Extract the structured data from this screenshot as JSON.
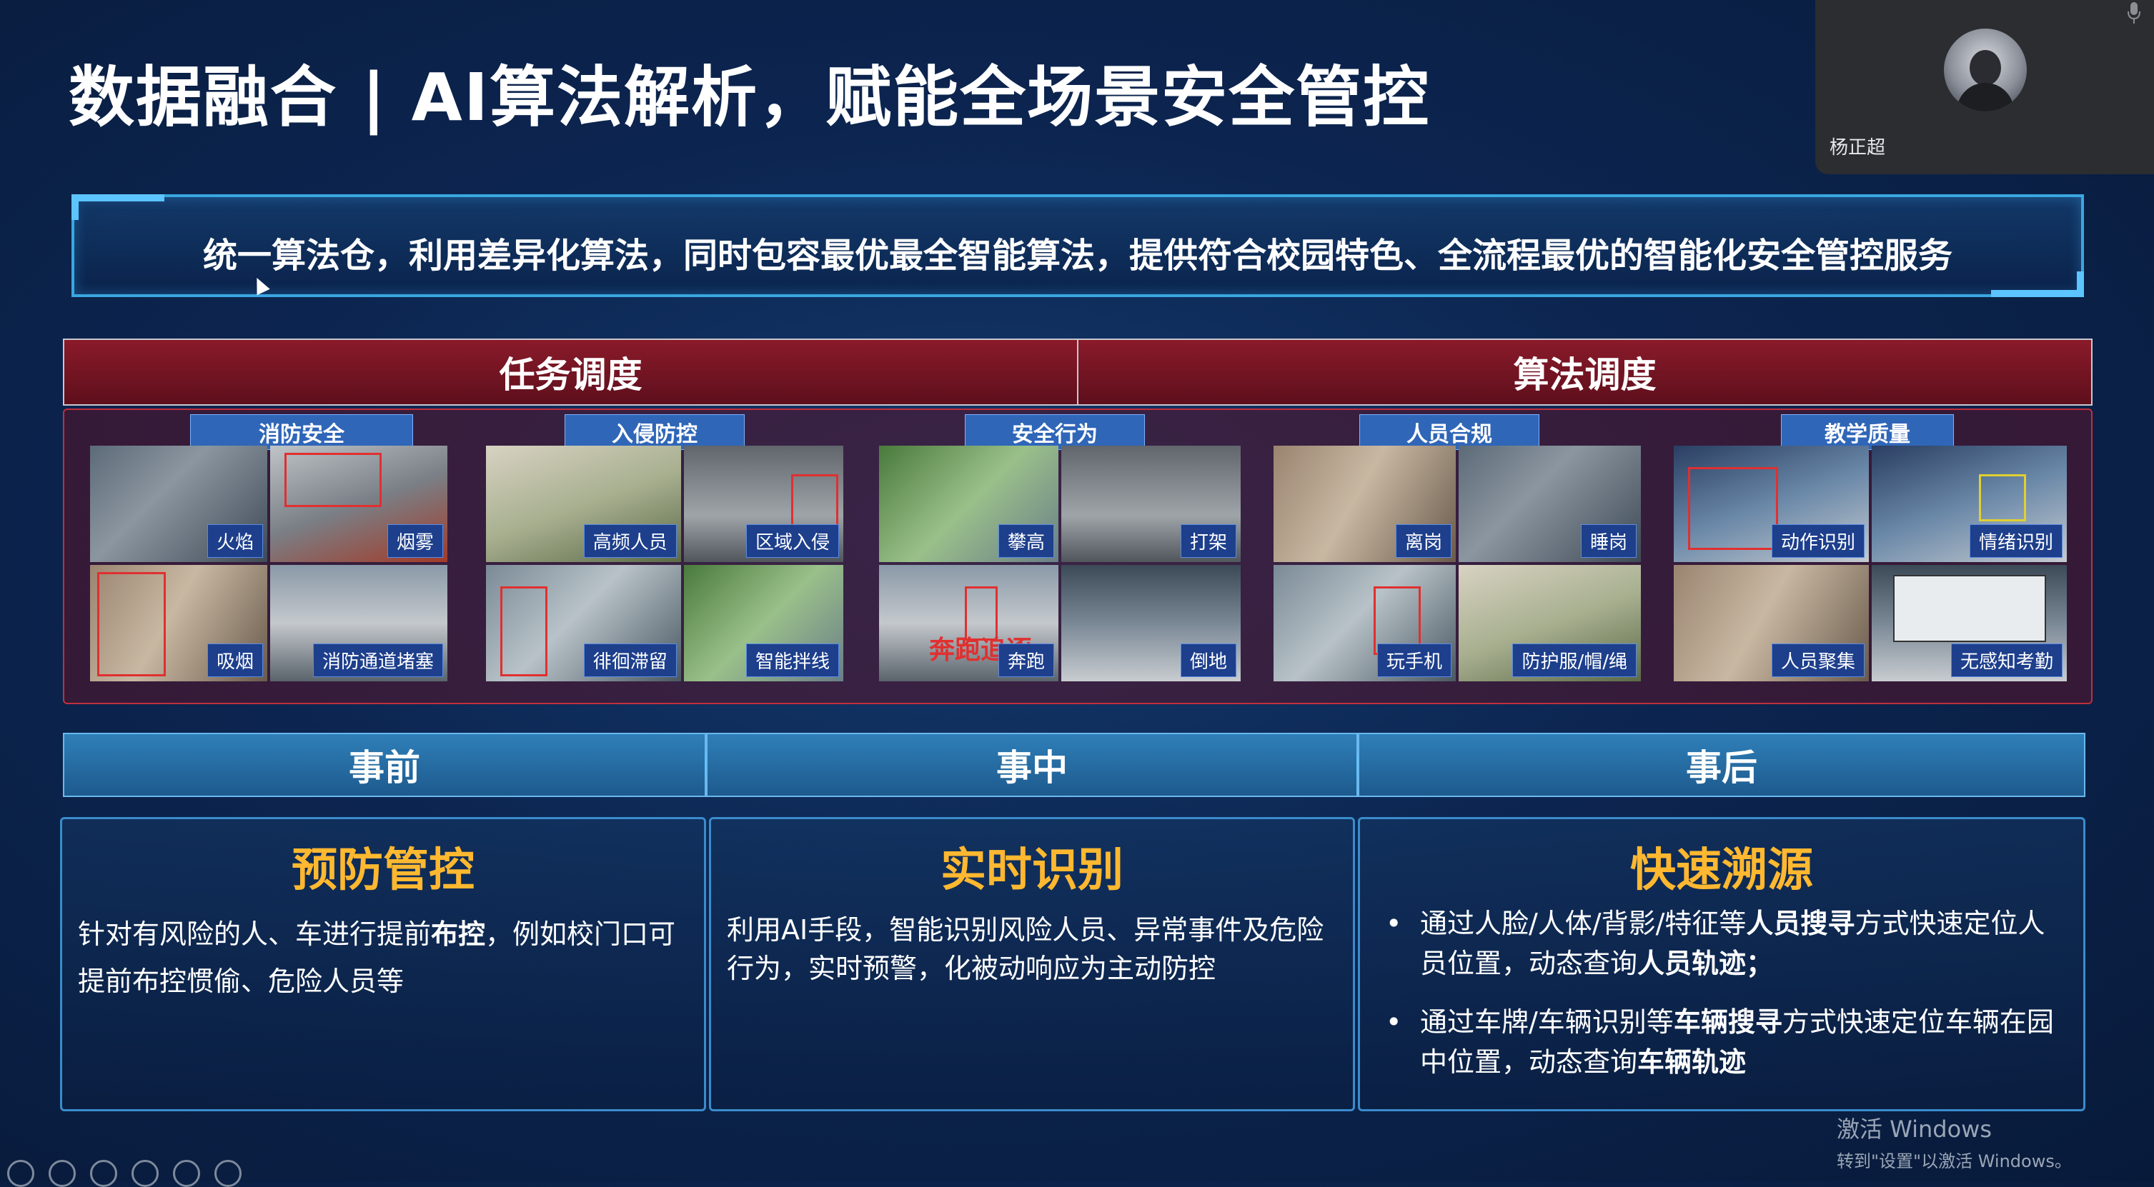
{
  "title": "数据融合 | AI算法解析，赋能全场景安全管控",
  "call": {
    "participant_name": "杨正超",
    "mic_icon": "microphone-icon"
  },
  "banner": "统一算法仓，利用差异化算法，同时包容最优最全智能算法，提供符合校园特色、全流程最优的智能化安全管控服务",
  "dispatch": {
    "task": "任务调度",
    "algorithm": "算法调度"
  },
  "categories": [
    {
      "title": "消防安全",
      "labels": [
        "火焰",
        "烟雾",
        "吸烟",
        "消防通道堵塞"
      ]
    },
    {
      "title": "入侵防控",
      "labels": [
        "高频人员",
        "区域入侵",
        "徘徊滞留",
        "智能拌线"
      ]
    },
    {
      "title": "安全行为",
      "labels": [
        "攀高",
        "打架",
        "奔跑",
        "倒地"
      ]
    },
    {
      "title": "人员合规",
      "labels": [
        "离岗",
        "睡岗",
        "玩手机",
        "防护服/帽/绳"
      ]
    },
    {
      "title": "教学质量",
      "labels": [
        "动作识别",
        "情绪识别",
        "人员聚集",
        "无感知考勤"
      ]
    }
  ],
  "overlay_text": "奔跑追逐",
  "phases": [
    "事前",
    "事中",
    "事后"
  ],
  "cards": [
    {
      "heading": "预防管控",
      "text_a": "针对有风险的人、车进行提前",
      "text_bold": "布控",
      "text_b": "，例如校门口可提前布控惯偷、危险人员等"
    },
    {
      "heading": "实时识别",
      "text": "利用AI手段，智能识别风险人员、异常事件及危险行为，实时预警，化被动响应为主动防控"
    },
    {
      "heading": "快速溯源",
      "bullet1": {
        "a": "通过人脸/人体/背影/特征等",
        "b1": "人员搜寻",
        "c": "方式快速定位人员位置，动态查询",
        "b2": "人员轨迹",
        "d": "；"
      },
      "bullet2": {
        "a": "通过车牌/车辆识别等",
        "b1": "车辆搜寻",
        "c": "方式快速定位车辆在园中位置，动态查询",
        "b2": "车辆轨迹",
        "d": ""
      },
      "bullet_char": "•"
    }
  ],
  "watermark": {
    "line1": "激活 Windows",
    "line2": "转到\"设置\"以激活 Windows。"
  },
  "colors": {
    "accent_orange": "#ffb830",
    "dispatch_red": "#8a1a2a",
    "phase_blue": "#2f7fb8",
    "banner_border": "#3aa7e0"
  }
}
